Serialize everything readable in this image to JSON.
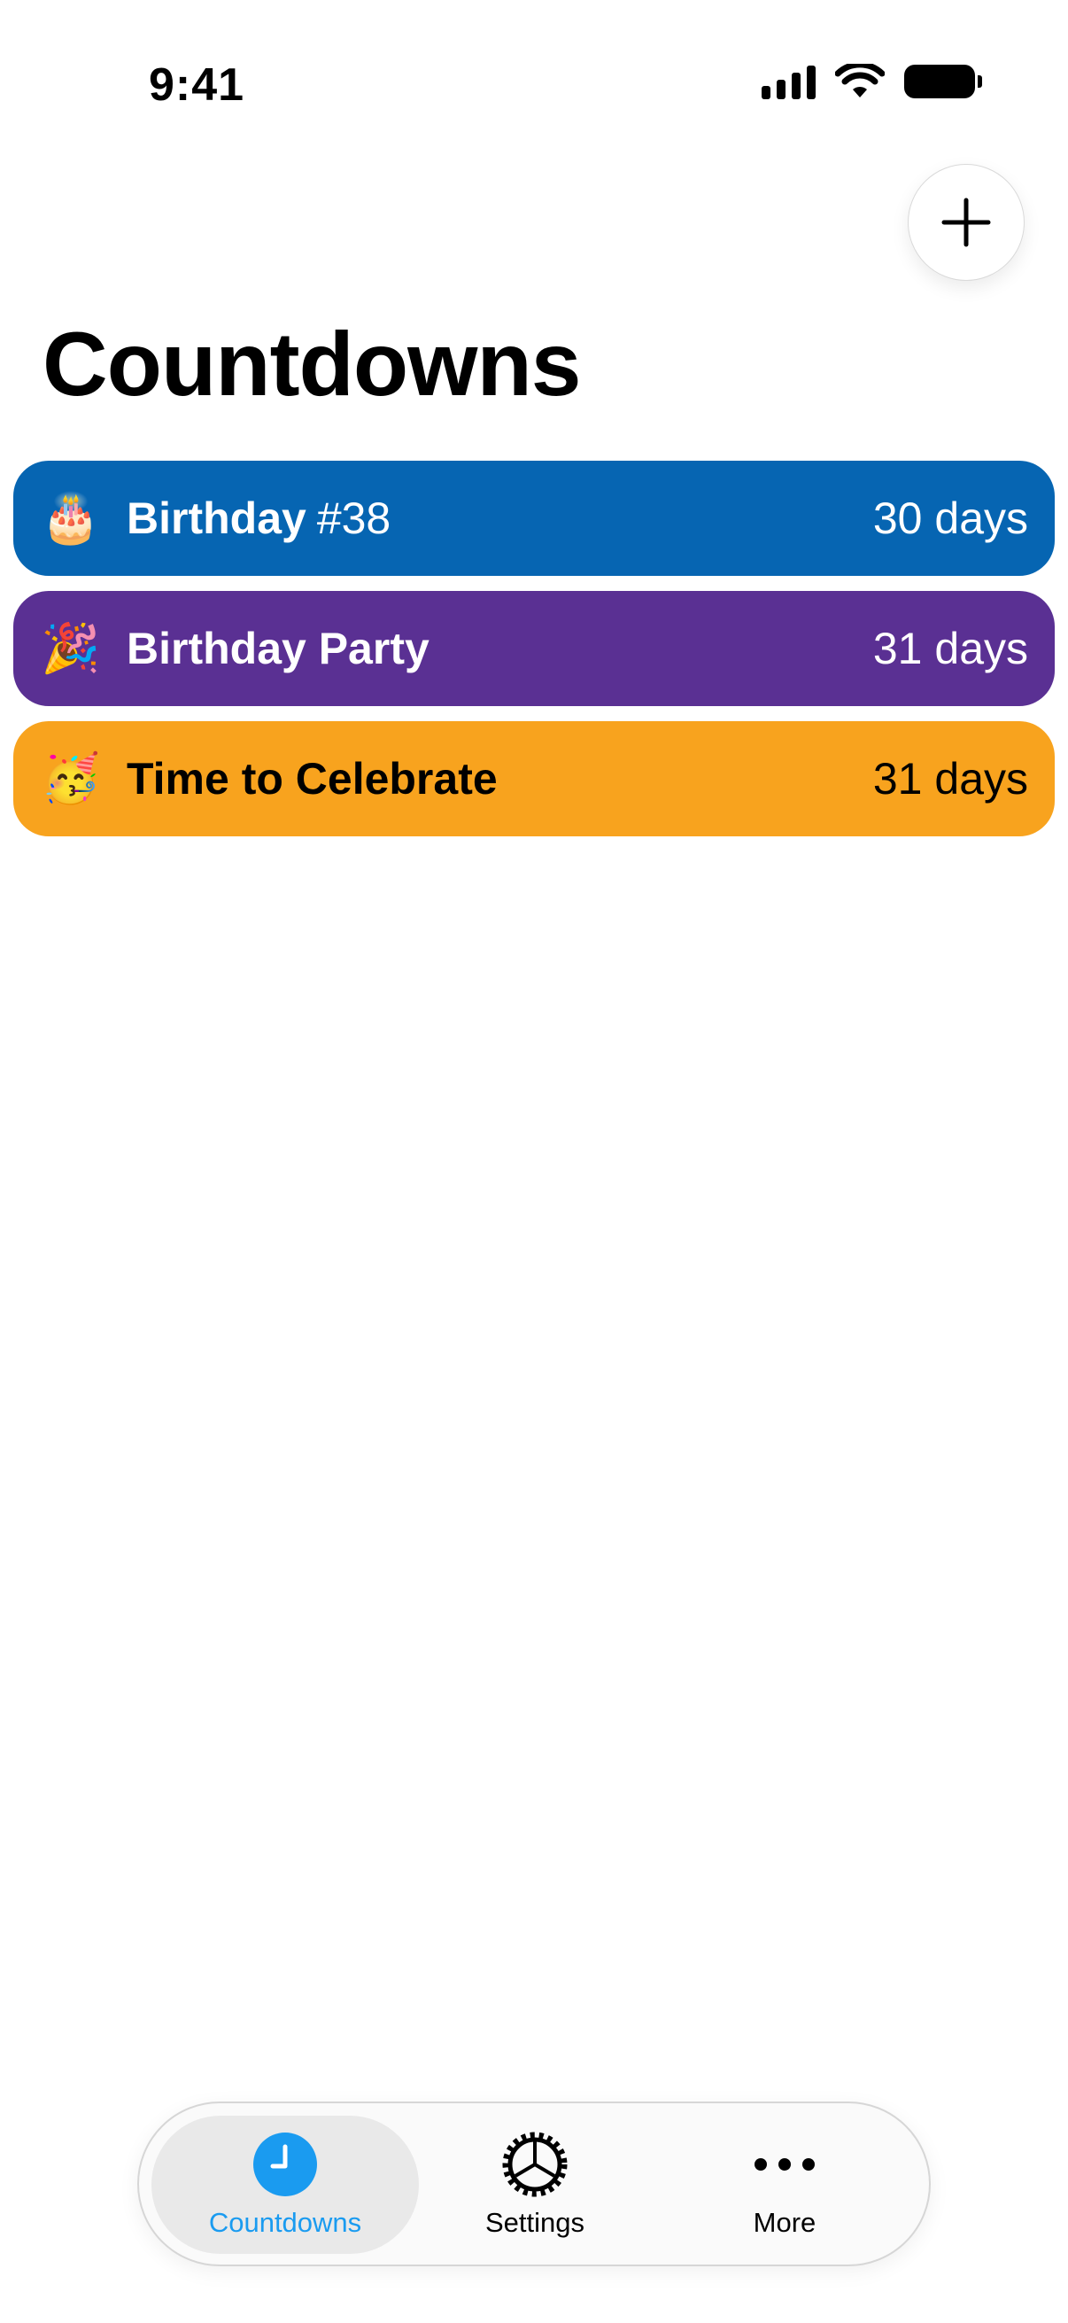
{
  "status_bar": {
    "time": "9:41"
  },
  "header": {
    "title": "Countdowns",
    "add_icon": "plus-icon"
  },
  "countdowns": [
    {
      "emoji": "🎂",
      "title": "Birthday",
      "suffix": "#38",
      "days": "30 days",
      "bg": "#0665B2",
      "fg": "#FFFFFF"
    },
    {
      "emoji": "🎉",
      "title": "Birthday Party",
      "suffix": "",
      "days": "31 days",
      "bg": "#5A3093",
      "fg": "#FFFFFF"
    },
    {
      "emoji": "🥳",
      "title": "Time to Celebrate",
      "suffix": "",
      "days": "31 days",
      "bg": "#F8A31E",
      "fg": "#000000"
    }
  ],
  "tab_bar": {
    "tabs": [
      {
        "label": "Countdowns",
        "icon": "clock-icon",
        "active": true
      },
      {
        "label": "Settings",
        "icon": "gear-icon",
        "active": false
      },
      {
        "label": "More",
        "icon": "ellipsis-icon",
        "active": false
      }
    ],
    "active_color": "#1A9BF0"
  }
}
